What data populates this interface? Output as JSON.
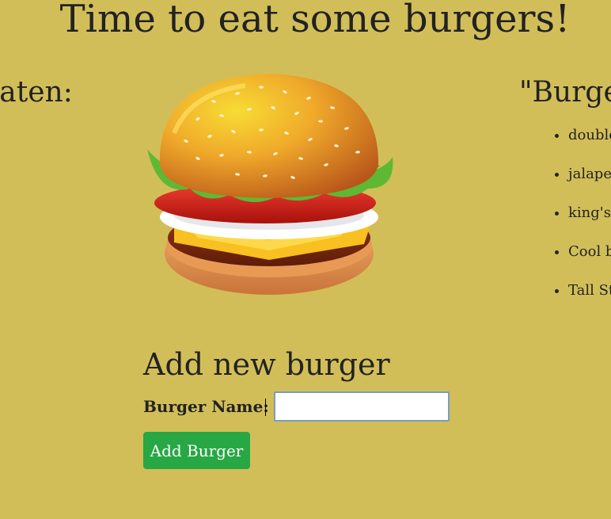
{
  "page": {
    "title": "Time to eat some burgers!"
  },
  "eaten_section": {
    "heading": "eaten:"
  },
  "burgers_section": {
    "heading": "\"Burge",
    "items": [
      {
        "name": "double"
      },
      {
        "name": "jalape"
      },
      {
        "name": "king's"
      },
      {
        "name": "Cool b"
      },
      {
        "name": "Tall St"
      }
    ]
  },
  "form": {
    "heading": "Add new burger",
    "name_label": "Burger Name:",
    "name_value": "",
    "submit_label": "Add Burger"
  },
  "colors": {
    "background": "#d2be59",
    "button": "#28a745"
  },
  "image": {
    "icon": "burger-illustration"
  }
}
